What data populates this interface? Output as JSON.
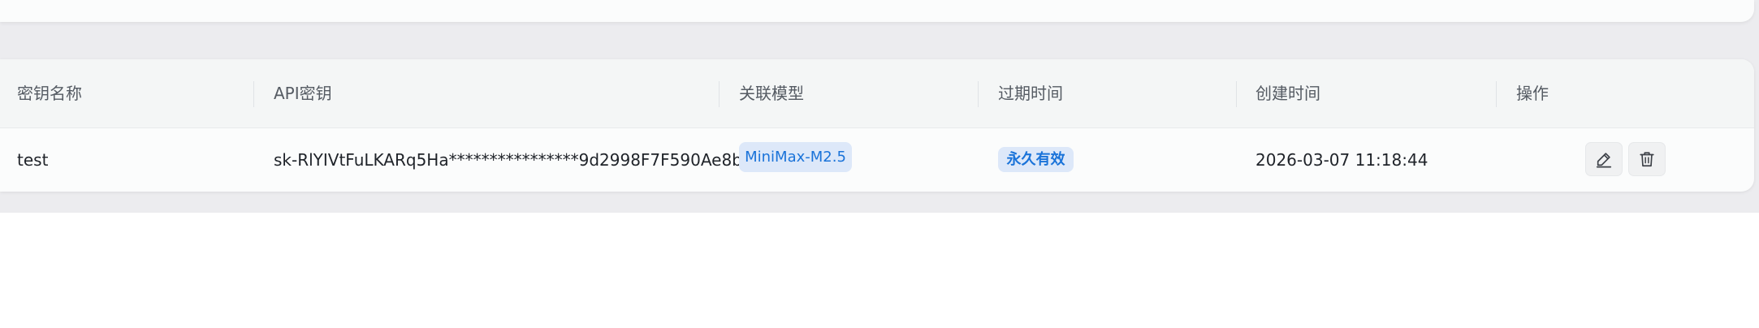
{
  "table": {
    "headers": {
      "name": "密钥名称",
      "api_key": "API密钥",
      "model": "关联模型",
      "expire": "过期时间",
      "created": "创建时间",
      "actions": "操作"
    },
    "rows": [
      {
        "name": "test",
        "api_key": "sk-RlYIVtFuLKARq5Ha****************9d2998F7F590Ae8b",
        "model": "MiniMax-M2.5",
        "expire": "永久有效",
        "created": "2026-03-07 11:18:44",
        "actions": [
          "edit-icon",
          "trash-icon"
        ]
      }
    ]
  },
  "colors": {
    "tag_bg": "#dde8f9",
    "tag_text": "#1a73d9",
    "header_bg": "#f4f6f6",
    "page_bg": "#ececef"
  }
}
